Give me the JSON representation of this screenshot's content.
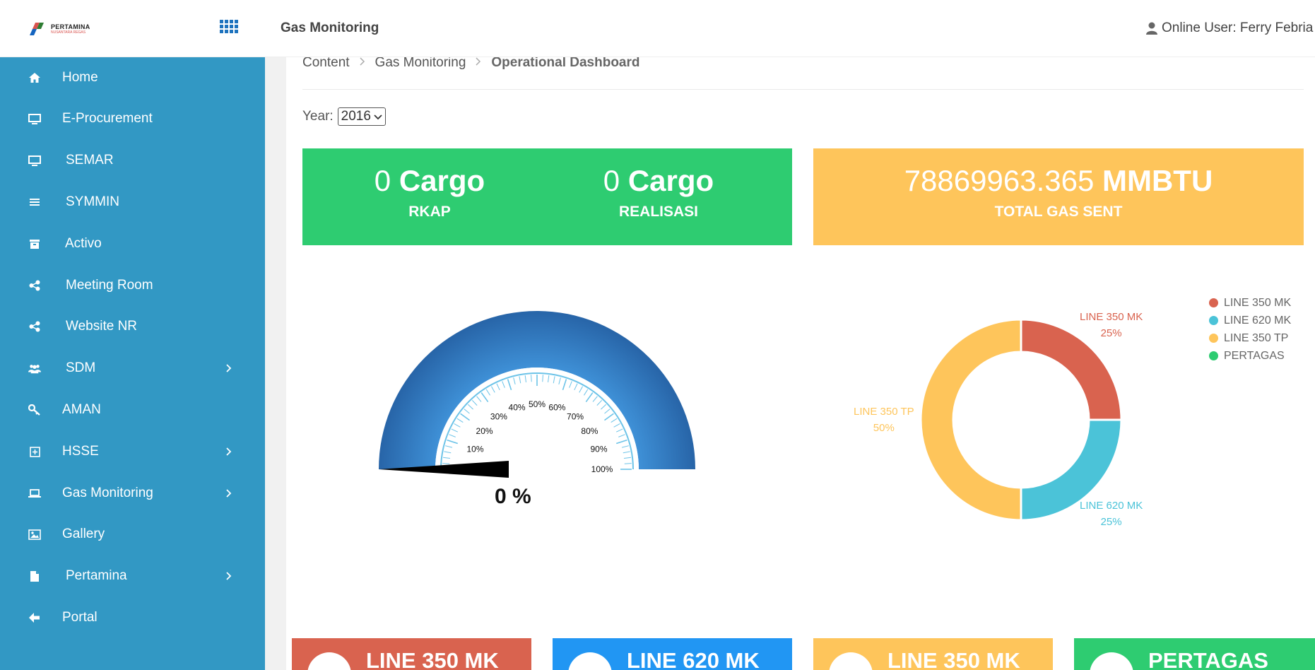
{
  "header": {
    "logo_name": "PERTAMINA",
    "logo_sub": "NUSANTARA REGAS",
    "app_title": "Gas Monitoring",
    "online_user": "Online User: Ferry Febria"
  },
  "sidebar": {
    "items": [
      {
        "label": "Home",
        "icon": "home-icon",
        "has_chevron": false
      },
      {
        "label": "E-Procurement",
        "icon": "monitor-icon",
        "has_chevron": false
      },
      {
        "label": "SEMAR",
        "icon": "monitor-icon",
        "has_chevron": false
      },
      {
        "label": "SYMMIN",
        "icon": "list-icon",
        "has_chevron": false
      },
      {
        "label": "Activo",
        "icon": "archive-icon",
        "has_chevron": false
      },
      {
        "label": "Meeting Room",
        "icon": "share-icon",
        "has_chevron": false
      },
      {
        "label": "Website NR",
        "icon": "share-icon",
        "has_chevron": false
      },
      {
        "label": "SDM",
        "icon": "users-icon",
        "has_chevron": true
      },
      {
        "label": "AMAN",
        "icon": "key-icon",
        "has_chevron": false
      },
      {
        "label": "HSSE",
        "icon": "plus-square-icon",
        "has_chevron": true
      },
      {
        "label": "Gas Monitoring",
        "icon": "laptop-icon",
        "has_chevron": true
      },
      {
        "label": "Gallery",
        "icon": "image-icon",
        "has_chevron": false
      },
      {
        "label": "Pertamina",
        "icon": "file-icon",
        "has_chevron": true
      },
      {
        "label": "Portal",
        "icon": "arrow-left-icon",
        "has_chevron": false
      }
    ]
  },
  "breadcrumb": {
    "items": [
      "Content",
      "Gas Monitoring"
    ],
    "current": "Operational Dashboard"
  },
  "filter": {
    "year_label": "Year:",
    "year_value": "2016"
  },
  "stats": {
    "rkap_value": "0",
    "rkap_unit": "Cargo",
    "rkap_label": "RKAP",
    "realisasi_value": "0",
    "realisasi_unit": "Cargo",
    "realisasi_label": "REALISASI",
    "gas_value": "78869963.365",
    "gas_unit": "MMBTU",
    "gas_label": "TOTAL GAS SENT"
  },
  "gauge": {
    "value_percent": 0,
    "display": "0 %",
    "ticks": [
      "10%",
      "20%",
      "30%",
      "40%",
      "50%",
      "60%",
      "70%",
      "80%",
      "90%",
      "100%"
    ]
  },
  "chart_data": {
    "type": "pie",
    "categories": [
      "LINE 350 MK",
      "LINE 620 MK",
      "LINE 350 TP",
      "PERTAGAS"
    ],
    "values": [
      25,
      25,
      50,
      0
    ],
    "labels": [
      "25%",
      "25%",
      "50%",
      ""
    ],
    "colors": [
      "#d9634f",
      "#4bc3d8",
      "#fec55b",
      "#2ecc71"
    ],
    "legend": "top-right",
    "donut": true
  },
  "colors": {
    "sidebar": "#3298c4",
    "green": "#2ecc71",
    "yellow": "#fec55b",
    "red": "#d9634f",
    "blue": "#2196f3"
  },
  "cards": [
    {
      "title": "LINE 350 MK",
      "color": "#d9634f"
    },
    {
      "title": "LINE 620 MK",
      "color": "#2196f3"
    },
    {
      "title": "LINE 350 MK",
      "color": "#fec55b"
    },
    {
      "title": "PERTAGAS",
      "color": "#2ecc71"
    }
  ]
}
